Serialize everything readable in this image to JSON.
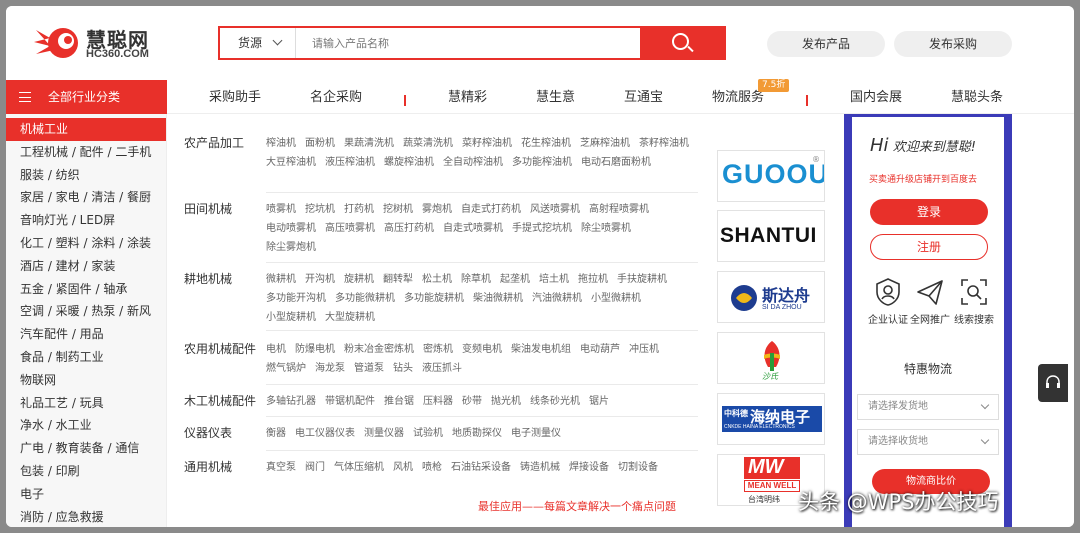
{
  "header": {
    "logo_text": "慧聪网",
    "logo_sub": "HC360.COM",
    "search_type": "货源",
    "search_placeholder": "请输入产品名称",
    "publish_product": "发布产品",
    "publish_purchase": "发布采购"
  },
  "nav": {
    "all_categories": "全部行业分类",
    "items": [
      "采购助手",
      "名企采购",
      "慧精彩",
      "慧生意",
      "互通宝",
      "物流服务",
      "国内会展",
      "慧聪头条"
    ],
    "badge": "7.5折"
  },
  "sidebar": {
    "items": [
      "机械工业",
      "工程机械 / 配件 / 二手机",
      "服装 / 纺织",
      "家居 / 家电 / 清洁 / 餐厨",
      "音响灯光 / LED屏",
      "化工 / 塑料 / 涂料 / 涂装",
      "酒店 / 建材 / 家装",
      "五金 / 紧固件 / 轴承",
      "空调 / 采暖 / 热泵 / 新风",
      "汽车配件 / 用品",
      "食品 / 制药工业",
      "物联网",
      "礼品工艺 / 玩具",
      "净水 / 水工业",
      "广电 / 教育装备 / 通信",
      "包装 / 印刷",
      "电子",
      "消防 / 应急救援"
    ]
  },
  "sections": [
    {
      "title": "农产品加工",
      "links": [
        "榨油机",
        "面粉机",
        "果蔬清洗机",
        "蔬菜清洗机",
        "菜籽榨油机",
        "花生榨油机",
        "芝麻榨油机",
        "茶籽榨油机",
        "大豆榨油机",
        "液压榨油机",
        "螺旋榨油机",
        "全自动榨油机",
        "多功能榨油机",
        "电动石磨面粉机"
      ]
    },
    {
      "title": "田间机械",
      "links": [
        "喷雾机",
        "挖坑机",
        "打药机",
        "挖树机",
        "雾炮机",
        "自走式打药机",
        "风送喷雾机",
        "高射程喷雾机",
        "电动喷雾机",
        "高压喷雾机",
        "高压打药机",
        "自走式喷雾机",
        "手提式挖坑机",
        "除尘喷雾机",
        "除尘雾炮机"
      ]
    },
    {
      "title": "耕地机械",
      "links": [
        "微耕机",
        "开沟机",
        "旋耕机",
        "翻转犁",
        "松土机",
        "除草机",
        "起垄机",
        "培土机",
        "拖拉机",
        "手扶旋耕机",
        "多功能开沟机",
        "多功能微耕机",
        "多功能旋耕机",
        "柴油微耕机",
        "汽油微耕机",
        "小型微耕机",
        "小型旋耕机",
        "大型旋耕机"
      ]
    },
    {
      "title": "农用机械配件",
      "links": [
        "电机",
        "防爆电机",
        "粉末冶金密炼机",
        "密炼机",
        "变频电机",
        "柴油发电机组",
        "电动葫芦",
        "冲压机",
        "燃气锅炉",
        "海龙泵",
        "管道泵",
        "钻头",
        "液压抓斗"
      ]
    },
    {
      "title": "木工机械配件",
      "links": [
        "多轴钻孔器",
        "带锯机配件",
        "推台锯",
        "压料器",
        "砂带",
        "抛光机",
        "线条砂光机",
        "锯片"
      ]
    },
    {
      "title": "仪器仪表",
      "links": [
        "衡器",
        "电工仪器仪表",
        "测量仪器",
        "试验机",
        "地质勘探仪",
        "电子测量仪"
      ]
    },
    {
      "title": "通用机械",
      "links": [
        "真空泵",
        "阀门",
        "气体压缩机",
        "风机",
        "喷枪",
        "石油钻采设备",
        "铸造机械",
        "焊接设备",
        "切割设备"
      ]
    }
  ],
  "promo": "最佳应用——每篇文章解决一个痛点问题",
  "brands": [
    {
      "name": "GUOOU",
      "text": "GUOOU",
      "sup": "®"
    },
    {
      "name": "SHANTUI",
      "text": "SHANTUI"
    },
    {
      "name": "SIDAZHOU",
      "text": "斯达舟",
      "sub": "SI DA ZHOU"
    },
    {
      "name": "shasi",
      "text": "沙氏"
    },
    {
      "name": "CNKDE",
      "text": "海纳电子",
      "small": "中科德",
      "sub": "CNKDE HAINA ELECTRONICS"
    },
    {
      "name": "MEANWELL",
      "text": "MW",
      "sub": "MEAN WELL",
      "sub2": "台湾明纬"
    }
  ],
  "user_panel": {
    "hi": "Hi",
    "welcome": "欢迎来到慧聪!",
    "tip": "买卖通升级店铺开到百度去",
    "login": "登录",
    "register": "注册",
    "services": [
      "企业认证",
      "全网推广",
      "线索搜索"
    ],
    "logistics_title": "特惠物流",
    "ship_from": "请选择发货地",
    "ship_to": "请选择收货地",
    "compare": "物流商比价"
  },
  "watermark": "头条 @WPS办公技巧"
}
